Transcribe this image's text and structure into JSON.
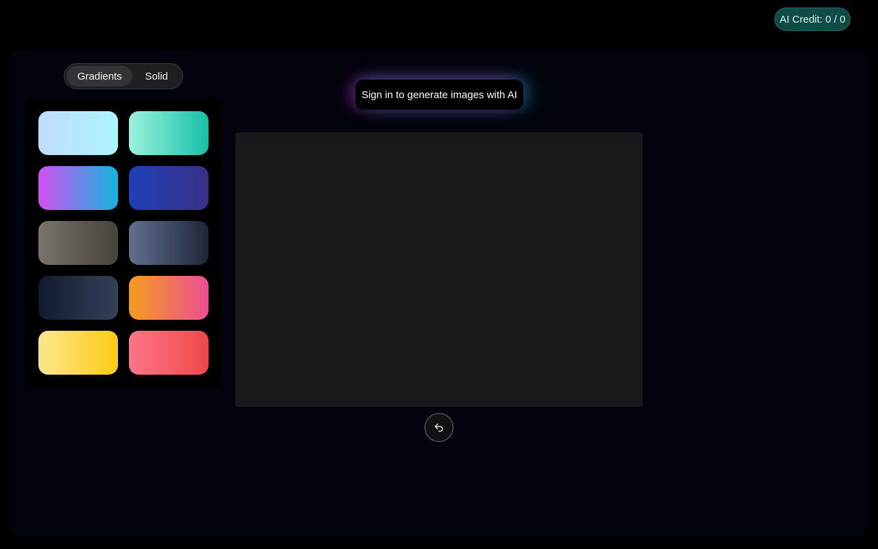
{
  "header": {
    "credit_label": "AI Credit: 0 / 0"
  },
  "background_picker": {
    "tabs": [
      {
        "label": "Gradients",
        "active": true
      },
      {
        "label": "Solid",
        "active": false
      }
    ],
    "gradients": [
      {
        "from": "#c3dbff",
        "to": "#aaf5fb"
      },
      {
        "from": "#9af2de",
        "to": "#17c0a6"
      },
      {
        "from": "#d14ff2",
        "to": "#12b6de"
      },
      {
        "from": "#1f40b7",
        "to": "#3b3088"
      },
      {
        "from": "#7a746e",
        "to": "#46423c"
      },
      {
        "from": "#627090",
        "to": "#1d2538"
      },
      {
        "from": "#121a2d",
        "to": "#334157"
      },
      {
        "from": "#f59d1e",
        "to": "#ec4d94"
      },
      {
        "from": "#fde68f",
        "to": "#fbcb12"
      },
      {
        "from": "#fd7687",
        "to": "#ef4848"
      }
    ]
  },
  "signin": {
    "label": "Sign in to generate images with AI"
  },
  "toolbar": {
    "undo_icon": "undo-arrow-icon"
  },
  "colors": {
    "badge_bg": "#0f4c47",
    "panel_bg": "#02040d",
    "canvas_bg": "#18191b"
  }
}
